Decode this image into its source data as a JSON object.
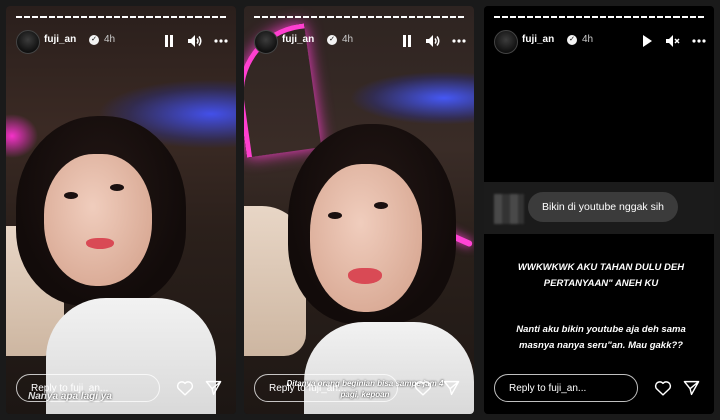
{
  "stories": [
    {
      "username": "fuji_an",
      "verified_mark": "✓",
      "time": "4h",
      "progress_segments": 26,
      "playback": "pause-icon",
      "sound": "volume-icon",
      "caption": "Nanya apa lagi ya",
      "reply_placeholder": "Reply to fuji_an..."
    },
    {
      "username": "fuji_an",
      "verified_mark": "✓",
      "time": "4h",
      "progress_segments": 26,
      "playback": "pause-icon",
      "sound": "volume-icon",
      "caption": "Ditanya orang beginian bisa sampe jam 4 pagi, kepoan",
      "reply_placeholder": "Reply to fuji_an..."
    },
    {
      "username": "fuji_an",
      "verified_mark": "✓",
      "time": "4h",
      "progress_segments": 26,
      "playback": "play-icon",
      "sound": "mute-icon",
      "question_bubble": "Bikin di youtube nggak sih",
      "text_1": "WWKWKWK AKU TAHAN DULU DEH PERTANYAAN\" ANEH KU",
      "text_2": "Nanti aku bikin youtube aja deh sama masnya nanya seru\"an. Mau gakk??",
      "reply_placeholder": "Reply to fuji_an..."
    }
  ],
  "colors": {
    "background": "#1a1a1a",
    "neon_pink": "#ff3fd0",
    "neon_blue": "#4454ff",
    "bubble": "#3b3b3b"
  }
}
